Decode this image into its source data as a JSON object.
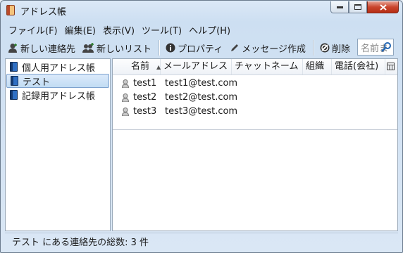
{
  "window": {
    "title": "アドレス帳"
  },
  "menu": [
    {
      "label": "ファイル(F)"
    },
    {
      "label": "編集(E)"
    },
    {
      "label": "表示(V)"
    },
    {
      "label": "ツール(T)"
    },
    {
      "label": "ヘルプ(H)"
    }
  ],
  "toolbar": {
    "new_contact": "新しい連絡先",
    "new_list": "新しいリスト",
    "properties": "プロパティ",
    "compose": "メッセージ作成",
    "delete": "削除",
    "search_placeholder": "名前ま"
  },
  "sidebar": {
    "items": [
      {
        "label": "個人用アドレス帳"
      },
      {
        "label": "テスト"
      },
      {
        "label": "記録用アドレス帳"
      }
    ]
  },
  "table": {
    "columns": [
      "名前",
      "メールアドレス",
      "チャットネーム",
      "組織",
      "電話(会社)"
    ],
    "rows": [
      {
        "name": "test1",
        "email": "test1@test.com"
      },
      {
        "name": "test2",
        "email": "test2@test.com"
      },
      {
        "name": "test3",
        "email": "test3@test.com"
      }
    ]
  },
  "status": {
    "text": "テスト にある連絡先の総数: 3 件"
  }
}
